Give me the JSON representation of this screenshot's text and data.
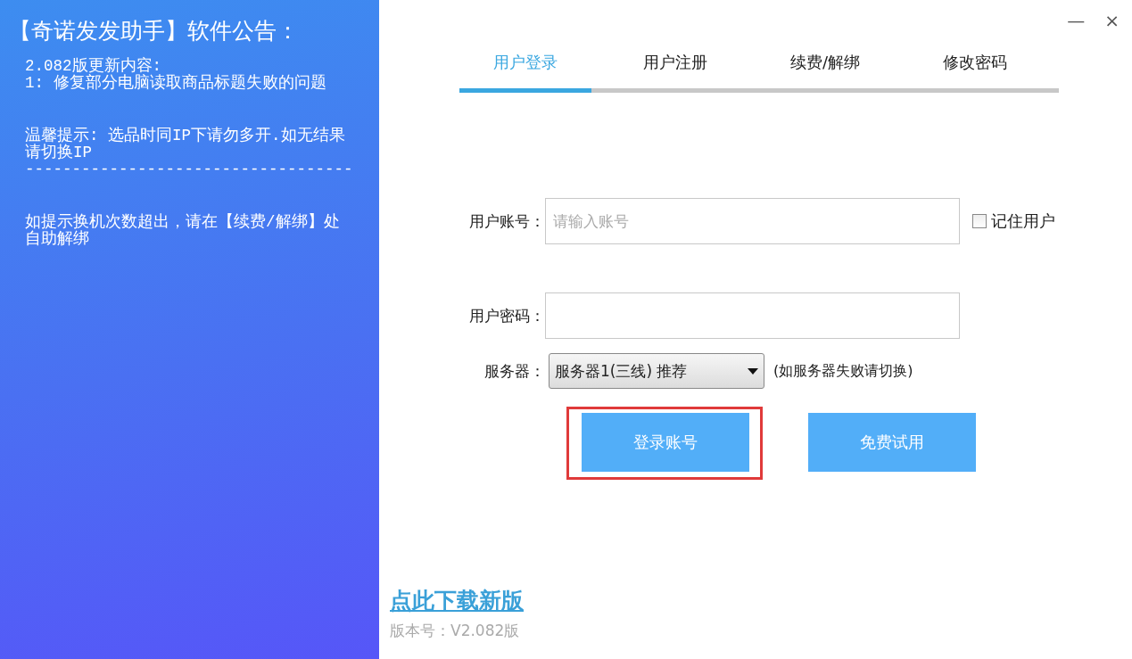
{
  "notice": {
    "title": "【奇诺发发助手】软件公告：",
    "paragraphs": [
      [
        "2.082版更新内容:",
        "1: 修复部分电脑读取商品标题失败的问题"
      ],
      [
        "温馨提示: 选品时同IP下请勿多开.如无结果请切换IP",
        "-----------------------------------"
      ],
      [
        "如提示换机次数超出，请在【续费/解绑】处自助解绑"
      ]
    ]
  },
  "window_controls": [
    "—",
    "×"
  ],
  "tabs": [
    {
      "label": "用户登录",
      "selected": true
    },
    {
      "label": "用户注册",
      "selected": false
    },
    {
      "label": "续费/解绑",
      "selected": false
    },
    {
      "label": "修改密码",
      "selected": false
    }
  ],
  "account": {
    "label": "用户账号：",
    "placeholder": "请输入账号"
  },
  "remember": {
    "label": "记住用户",
    "checked": false
  },
  "password": {
    "label": "用户密码："
  },
  "server": {
    "label": "服务器：",
    "value": "服务器1(三线) 推荐",
    "hint": "(如服务器失败请切换)"
  },
  "buttons": [
    {
      "label": "登录账号",
      "highlighted": true
    },
    {
      "label": "免费试用",
      "highlighted": false
    }
  ],
  "download_link": "点此下载新版",
  "version": "版本号：V2.082版"
}
